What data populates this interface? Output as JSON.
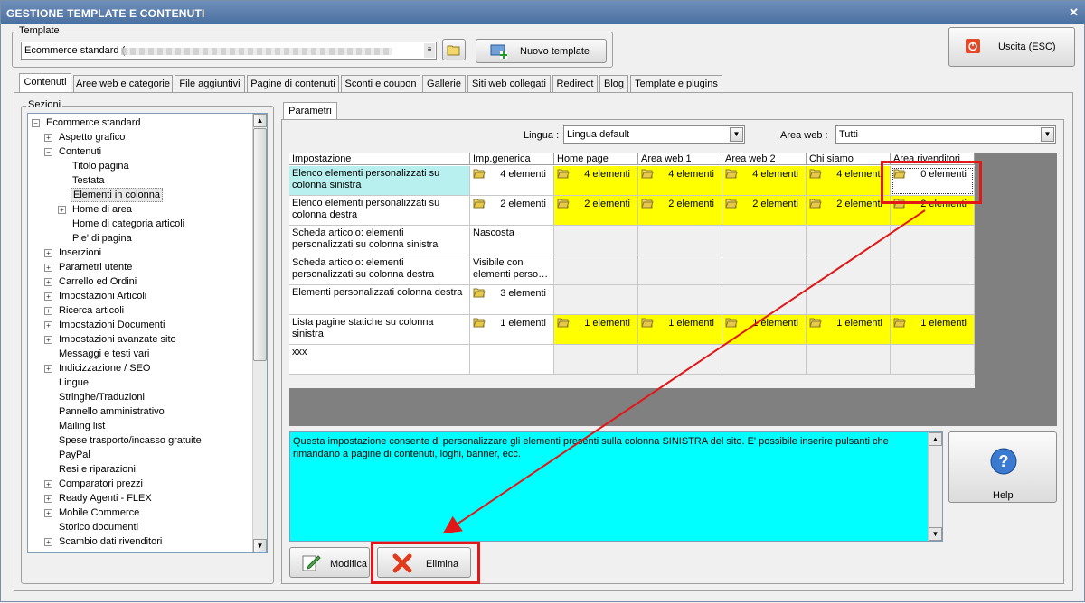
{
  "window": {
    "title": "GESTIONE TEMPLATE E CONTENUTI",
    "close_glyph": "✕"
  },
  "template": {
    "group_label": "Template",
    "selected": "Ecommerce standard (",
    "new_button": "Nuovo template",
    "exit_button": "Uscita (ESC)"
  },
  "tabs": [
    "Contenuti",
    "Aree web e categorie",
    "File aggiuntivi",
    "Pagine di contenuti",
    "Sconti e coupon",
    "Gallerie",
    "Siti web collegati",
    "Redirect",
    "Blog",
    "Template e plugins"
  ],
  "sections": {
    "group_label": "Sezioni",
    "items": [
      {
        "label": "Ecommerce standard",
        "level": 0,
        "toggle": "−"
      },
      {
        "label": "Aspetto grafico",
        "level": 1,
        "toggle": "+"
      },
      {
        "label": "Contenuti",
        "level": 1,
        "toggle": "−"
      },
      {
        "label": "Titolo pagina",
        "level": 2,
        "toggle": ""
      },
      {
        "label": "Testata",
        "level": 2,
        "toggle": ""
      },
      {
        "label": "Elementi in colonna",
        "level": 2,
        "toggle": "",
        "selected": true
      },
      {
        "label": "Home di area",
        "level": 2,
        "toggle": "+"
      },
      {
        "label": "Home di categoria articoli",
        "level": 2,
        "toggle": ""
      },
      {
        "label": "Pie' di pagina",
        "level": 2,
        "toggle": ""
      },
      {
        "label": "Inserzioni",
        "level": 1,
        "toggle": "+"
      },
      {
        "label": "Parametri utente",
        "level": 1,
        "toggle": "+"
      },
      {
        "label": "Carrello ed Ordini",
        "level": 1,
        "toggle": "+"
      },
      {
        "label": "Impostazioni Articoli",
        "level": 1,
        "toggle": "+"
      },
      {
        "label": "Ricerca articoli",
        "level": 1,
        "toggle": "+"
      },
      {
        "label": "Impostazioni Documenti",
        "level": 1,
        "toggle": "+"
      },
      {
        "label": "Impostazioni avanzate sito",
        "level": 1,
        "toggle": "+"
      },
      {
        "label": "Messaggi e testi vari",
        "level": 1,
        "toggle": ""
      },
      {
        "label": "Indicizzazione / SEO",
        "level": 1,
        "toggle": "+"
      },
      {
        "label": "Lingue",
        "level": 1,
        "toggle": ""
      },
      {
        "label": "Stringhe/Traduzioni",
        "level": 1,
        "toggle": ""
      },
      {
        "label": "Pannello amministrativo",
        "level": 1,
        "toggle": ""
      },
      {
        "label": "Mailing list",
        "level": 1,
        "toggle": ""
      },
      {
        "label": "Spese trasporto/incasso gratuite",
        "level": 1,
        "toggle": ""
      },
      {
        "label": "PayPal",
        "level": 1,
        "toggle": ""
      },
      {
        "label": "Resi e riparazioni",
        "level": 1,
        "toggle": ""
      },
      {
        "label": "Comparatori prezzi",
        "level": 1,
        "toggle": "+"
      },
      {
        "label": "Ready Agenti - FLEX",
        "level": 1,
        "toggle": "+"
      },
      {
        "label": "Mobile Commerce",
        "level": 1,
        "toggle": "+"
      },
      {
        "label": "Storico documenti",
        "level": 1,
        "toggle": ""
      },
      {
        "label": "Scambio dati rivenditori",
        "level": 1,
        "toggle": "+"
      }
    ]
  },
  "params": {
    "tab_label": "Parametri",
    "lingua_label": "Lingua :",
    "lingua_value": "Lingua default",
    "area_label": "Area web :",
    "area_value": "Tutti"
  },
  "grid": {
    "columns": [
      "Impostazione",
      "Imp.generica",
      "Home page",
      "Area web 1",
      "Area web 2",
      "Chi siamo",
      "Area rivenditori"
    ],
    "rows": [
      {
        "name": "Elenco elementi personalizzati su colonna sinistra",
        "cells": [
          "4 elementi",
          "4 elementi",
          "4 elementi",
          "4 elementi",
          "4 elementi",
          "0 elementi"
        ],
        "highlight": true
      },
      {
        "name": "Elenco elementi personalizzati su colonna destra",
        "cells": [
          "2 elementi",
          "2 elementi",
          "2 elementi",
          "2 elementi",
          "2 elementi",
          "2 elementi"
        ],
        "highlight": true
      },
      {
        "name": "Scheda articolo: elementi personalizzati su colonna sinistra",
        "cells": [
          "Nascosta",
          "",
          "",
          "",
          "",
          ""
        ],
        "highlight": false
      },
      {
        "name": "Scheda articolo: elementi personalizzati su colonna destra",
        "cells": [
          "Visibile con elementi perso…",
          "",
          "",
          "",
          "",
          ""
        ],
        "highlight": false
      },
      {
        "name": "Elementi personalizzati colonna destra",
        "cells": [
          "3 elementi",
          "",
          "",
          "",
          "",
          ""
        ],
        "highlight": false
      },
      {
        "name": "Lista pagine statiche su colonna sinistra",
        "cells": [
          "1 elementi",
          "1 elementi",
          "1 elementi",
          "1 elementi",
          "1 elementi",
          "1 elementi"
        ],
        "highlight": true
      },
      {
        "name": "xxx",
        "cells": [
          "",
          "",
          "",
          "",
          "",
          ""
        ],
        "highlight": false
      }
    ]
  },
  "description": "Questa impostazione consente di personalizzare gli elementi presenti sulla colonna SINISTRA del sito. E' possibile inserire pulsanti che rimandano a pagine di contenuti, loghi, banner, ecc.",
  "help_button": "Help",
  "actions": {
    "edit": "Modifica",
    "delete": "Elimina"
  },
  "colors": {
    "highlight": "#ffff00",
    "selected_row": "#b8f0f0",
    "description_bg": "#00ffff",
    "annotation": "#e01818",
    "title_bar": "#5a7dae"
  }
}
